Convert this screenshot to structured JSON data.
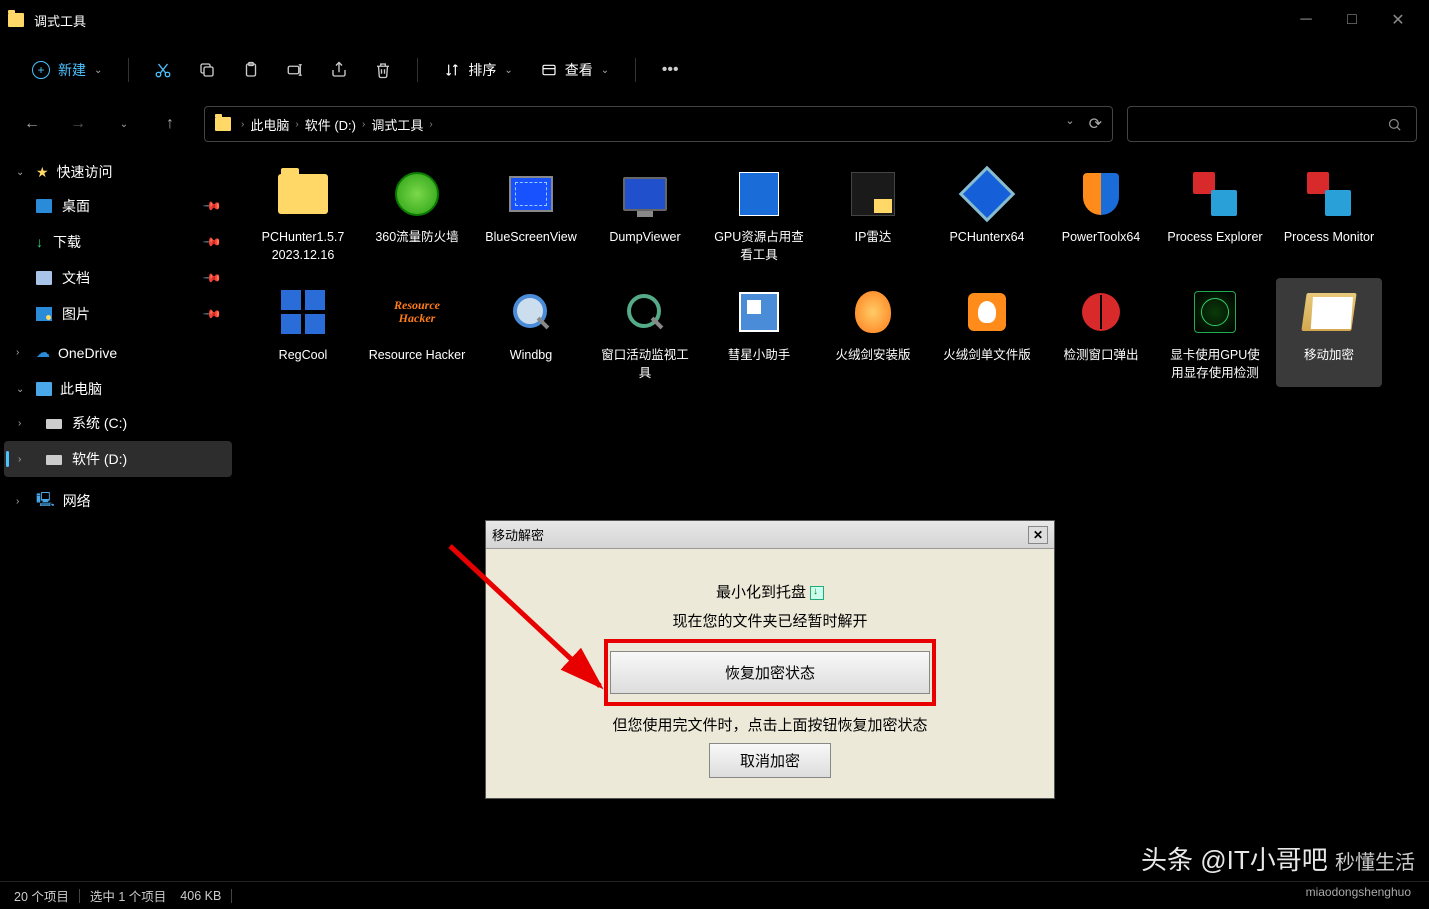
{
  "window": {
    "title": "调式工具"
  },
  "toolbar": {
    "new_label": "新建",
    "sort_label": "排序",
    "view_label": "查看"
  },
  "breadcrumb": {
    "items": [
      "此电脑",
      "软件 (D:)",
      "调式工具"
    ]
  },
  "sidebar": {
    "quick": {
      "label": "快速访问"
    },
    "quick_items": [
      {
        "label": "桌面"
      },
      {
        "label": "下载"
      },
      {
        "label": "文档"
      },
      {
        "label": "图片"
      }
    ],
    "onedrive": "OneDrive",
    "this_pc": "此电脑",
    "drives": [
      {
        "label": "系统 (C:)"
      },
      {
        "label": "软件 (D:)"
      }
    ],
    "network": "网络"
  },
  "files": [
    {
      "label": "PCHunter1.5.7 2023.12.16",
      "icon": "folder"
    },
    {
      "label": "360流量防火墙",
      "icon": "green-circle"
    },
    {
      "label": "BlueScreenView",
      "icon": "bluescreen"
    },
    {
      "label": "DumpViewer",
      "icon": "monitor"
    },
    {
      "label": "GPU资源占用查看工具",
      "icon": "gpu"
    },
    {
      "label": "IP雷达",
      "icon": "radar"
    },
    {
      "label": "PCHunterx64",
      "icon": "shield-diamond"
    },
    {
      "label": "PowerToolx64",
      "icon": "shield"
    },
    {
      "label": "Process Explorer",
      "icon": "proc"
    },
    {
      "label": "Process Monitor",
      "icon": "proc"
    },
    {
      "label": "RegCool",
      "icon": "grid"
    },
    {
      "label": "Resource Hacker",
      "icon": "rhacker"
    },
    {
      "label": "Windbg",
      "icon": "mag-blue"
    },
    {
      "label": "窗口活动监视工具",
      "icon": "mag"
    },
    {
      "label": "彗星小助手",
      "icon": "blue-sq"
    },
    {
      "label": "火绒剑安装版",
      "icon": "flame"
    },
    {
      "label": "火绒剑单文件版",
      "icon": "flame-box"
    },
    {
      "label": "检测窗口弹出",
      "icon": "ladybug"
    },
    {
      "label": "显卡使用GPU使用显存使用检测",
      "icon": "radar-green"
    },
    {
      "label": "移动加密",
      "icon": "folder-open",
      "selected": true
    }
  ],
  "dialog": {
    "title": "移动解密",
    "minimize": "最小化到托盘",
    "msg1": "现在您的文件夹已经暂时解开",
    "restore_btn": "恢复加密状态",
    "msg2": "但您使用完文件时，点击上面按钮恢复加密状态",
    "cancel_btn": "取消加密"
  },
  "statusbar": {
    "count": "20 个项目",
    "selected": "选中 1 个项目",
    "size": "406 KB"
  },
  "watermark": {
    "main": "头条 @IT小哥吧",
    "sub": "秒懂生活",
    "url": "miaodongshenghuo"
  }
}
